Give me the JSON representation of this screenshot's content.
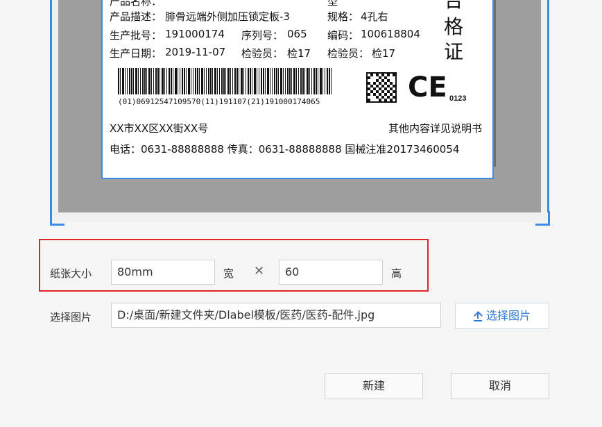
{
  "label": {
    "top_cut_left": "产品名称：",
    "top_cut_right": "型",
    "desc_label": "产品描述：",
    "desc_value": "腓骨远端外侧加压锁定板-3",
    "spec_label": "规格：",
    "spec_value": "4孔右",
    "batch_label": "生产批号：",
    "batch_value": "191000174",
    "serial_label": "序列号：",
    "serial_value": "065",
    "code_label": "编码：",
    "code_value": "100618804",
    "date_label": "生产日期：",
    "date_value": "2019-11-07",
    "inspector1_label": "检验员：",
    "inspector1_value": "检17",
    "inspector2_label": "检验员：",
    "inspector2_value": "检17",
    "cert_chars": [
      "合",
      "格",
      "证"
    ],
    "barcode_text": "(01)06912547109570(11)191107(21)191000174065",
    "ce_mark": "CE",
    "ce_number": "0123",
    "address": "XX市XX区XX街XX号",
    "manual_note": "其他内容详见说明书",
    "contact_line": "电话：0631-88888888 传真：0631-88888888 国械注准20173460054"
  },
  "form": {
    "paper_size_label": "纸张大小",
    "width_value": "80mm",
    "width_unit": "宽",
    "times": "✕",
    "height_value": "60",
    "height_unit": "高",
    "image_label": "选择图片",
    "image_path": "D:/桌面/新建文件夹/Dlabel模板/医药/医药-配件.jpg",
    "choose_image_button": "选择图片"
  },
  "buttons": {
    "create": "新建",
    "cancel": "取消"
  },
  "colors": {
    "highlight": "#e02424",
    "accent": "#3c8ce7",
    "link": "#2f7bd8"
  }
}
